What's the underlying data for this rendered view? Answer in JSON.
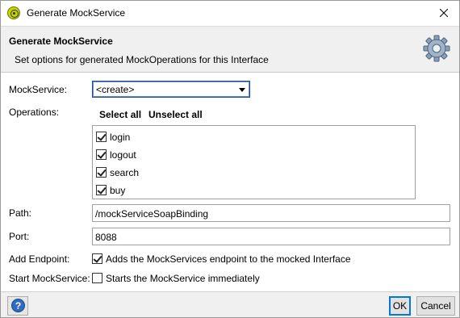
{
  "window": {
    "title": "Generate MockService",
    "close_label": "✕"
  },
  "header": {
    "title": "Generate MockService",
    "description": "Set options for generated MockOperations for this Interface"
  },
  "form": {
    "mockservice": {
      "label": "MockService:",
      "selected": "<create>"
    },
    "operations": {
      "label": "Operations:",
      "select_all": "Select all",
      "unselect_all": "Unselect all",
      "items": [
        {
          "label": "login",
          "checked": true
        },
        {
          "label": "logout",
          "checked": true
        },
        {
          "label": "search",
          "checked": true
        },
        {
          "label": "buy",
          "checked": true
        }
      ]
    },
    "path": {
      "label": "Path:",
      "value": "/mockServiceSoapBinding"
    },
    "port": {
      "label": "Port:",
      "value": "8088"
    },
    "add_endpoint": {
      "label": "Add Endpoint:",
      "text": "Adds the MockServices endpoint to the mocked Interface",
      "checked": true
    },
    "start_mockservice": {
      "label": "Start MockService:",
      "text": "Starts the MockService immediately",
      "checked": false
    }
  },
  "footer": {
    "help_icon": "?",
    "ok_label": "OK",
    "cancel_label": "Cancel"
  }
}
